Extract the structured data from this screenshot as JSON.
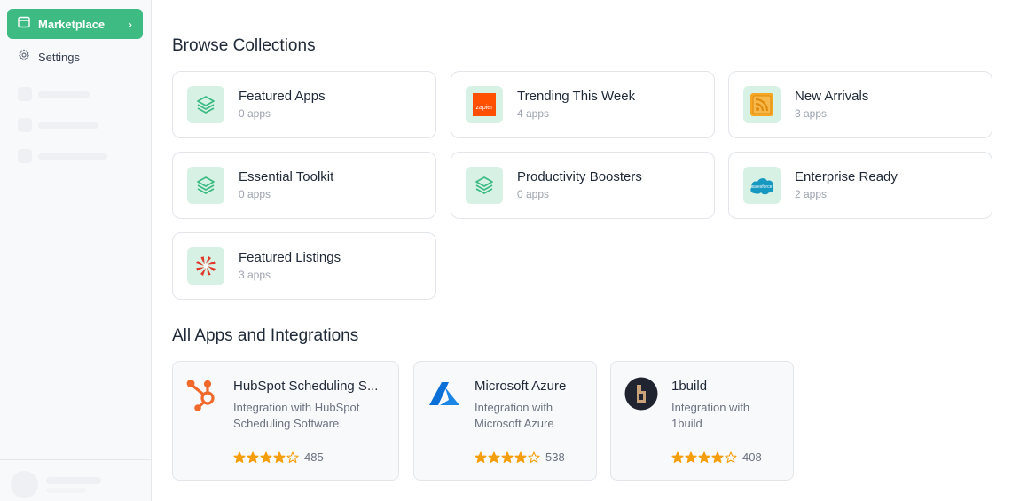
{
  "sidebar": {
    "active_item": {
      "label": "Marketplace",
      "icon": "browser-window-icon"
    },
    "items": [
      {
        "label": "Settings",
        "icon": "gear-icon"
      }
    ]
  },
  "collections": {
    "title": "Browse Collections",
    "items": [
      {
        "name": "Featured Apps",
        "count": "0 apps",
        "icon": "layers-icon"
      },
      {
        "name": "Trending This Week",
        "count": "4 apps",
        "icon": "zapier-logo",
        "logo_text": "zapier"
      },
      {
        "name": "New Arrivals",
        "count": "3 apps",
        "icon": "rss-icon"
      },
      {
        "name": "Essential Toolkit",
        "count": "0 apps",
        "icon": "layers-icon"
      },
      {
        "name": "Productivity Boosters",
        "count": "0 apps",
        "icon": "layers-icon"
      },
      {
        "name": "Enterprise Ready",
        "count": "2 apps",
        "icon": "salesforce-logo",
        "logo_text": "salesforce"
      },
      {
        "name": "Featured Listings",
        "count": "3 apps",
        "icon": "pinwheel-logo"
      }
    ]
  },
  "apps": {
    "title": "All Apps and Integrations",
    "items": [
      {
        "name": "HubSpot Scheduling S...",
        "desc_line1": "Integration with HubSpot",
        "desc_line2": "Scheduling Software",
        "rating": 4,
        "reviews": "485",
        "icon": "hubspot-logo"
      },
      {
        "name": "Microsoft Azure",
        "desc_line1": "Integration with",
        "desc_line2": "Microsoft Azure",
        "rating": 4,
        "reviews": "538",
        "icon": "azure-logo"
      },
      {
        "name": "1build",
        "desc_line1": "Integration with",
        "desc_line2": "1build",
        "rating": 4,
        "reviews": "408",
        "icon": "1build-logo"
      }
    ]
  },
  "colors": {
    "accent": "#3dbb82",
    "star": "#f59e0b",
    "icon_bg": "#d7f2e5"
  }
}
